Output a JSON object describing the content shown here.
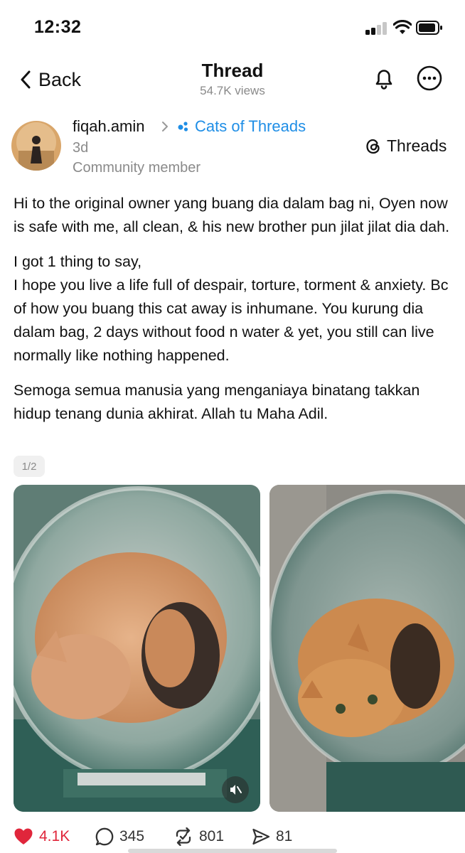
{
  "status_bar": {
    "time": "12:32",
    "icons": [
      "signal-icon",
      "wifi-icon",
      "battery-icon"
    ]
  },
  "header": {
    "back_label": "Back",
    "title": "Thread",
    "views": "54.7K views",
    "icons": [
      "chevron-left-icon",
      "bell-icon",
      "more-icon"
    ]
  },
  "post": {
    "author": "fiqah.amin",
    "community": "Cats of Threads",
    "time": "3d",
    "role": "Community member",
    "brand": "Threads",
    "paragraphs": [
      "Hi to the original owner yang buang dia dalam bag ni, Oyen now is safe with me, all clean, & his new brother pun jilat jilat dia dah.",
      "I got 1 thing to say,\nI hope you live a life full of despair, torture, torment & anxiety. Bc of how you buang this cat away is inhumane. You kurung dia dalam bag, 2 days without food n water & yet, you still can live normally like nothing happened.",
      "Semoga semua manusia yang menganiaya binatang takkan hidup tenang dunia akhirat. Allah tu Maha Adil."
    ],
    "page_indicator": "1/2",
    "media_count": 2
  },
  "actions": {
    "likes": "4.1K",
    "replies": "345",
    "reposts": "801",
    "shares": "81"
  },
  "colors": {
    "accent_blue": "#1f8ee6",
    "like_red": "#e0263b",
    "secondary_text": "#8a8a8a"
  }
}
